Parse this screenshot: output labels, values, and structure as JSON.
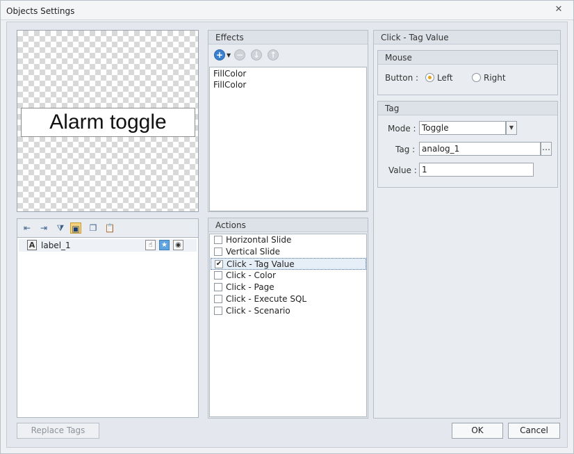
{
  "window": {
    "title": "Objects Settings",
    "close_glyph": "✕"
  },
  "preview": {
    "label_text": "Alarm toggle"
  },
  "object_list": {
    "toolbar_icons": [
      "outdent-icon",
      "indent-icon",
      "filter-icon",
      "select-icon",
      "copy-icon",
      "paste-icon"
    ],
    "items": [
      {
        "label": "label_1",
        "type_glyph": "A"
      }
    ]
  },
  "effects": {
    "title": "Effects",
    "items": [
      "FillColor",
      "FillColor"
    ]
  },
  "actions": {
    "title": "Actions",
    "items": [
      {
        "label": "Horizontal Slide",
        "checked": false
      },
      {
        "label": "Vertical Slide",
        "checked": false
      },
      {
        "label": "Click - Tag Value",
        "checked": true
      },
      {
        "label": "Click - Color",
        "checked": false
      },
      {
        "label": "Click - Page",
        "checked": false
      },
      {
        "label": "Click - Execute SQL",
        "checked": false
      },
      {
        "label": "Click - Scenario",
        "checked": false
      }
    ]
  },
  "detail": {
    "title": "Click - Tag Value",
    "mouse": {
      "title": "Mouse",
      "button_label": "Button :",
      "option_left": "Left",
      "option_right": "Right",
      "selected": "Left"
    },
    "tag": {
      "title": "Tag",
      "mode_label": "Mode :",
      "mode_value": "Toggle",
      "tag_label": "Tag :",
      "tag_value": "analog_1",
      "value_label": "Value :",
      "value_value": "1"
    }
  },
  "buttons": {
    "replace_tags": "Replace Tags",
    "ok": "OK",
    "cancel": "Cancel"
  },
  "colors": {
    "accent_radio": "#e6a11a",
    "selection_border": "#4a6f9c",
    "add_button": "#3b7fd0"
  }
}
